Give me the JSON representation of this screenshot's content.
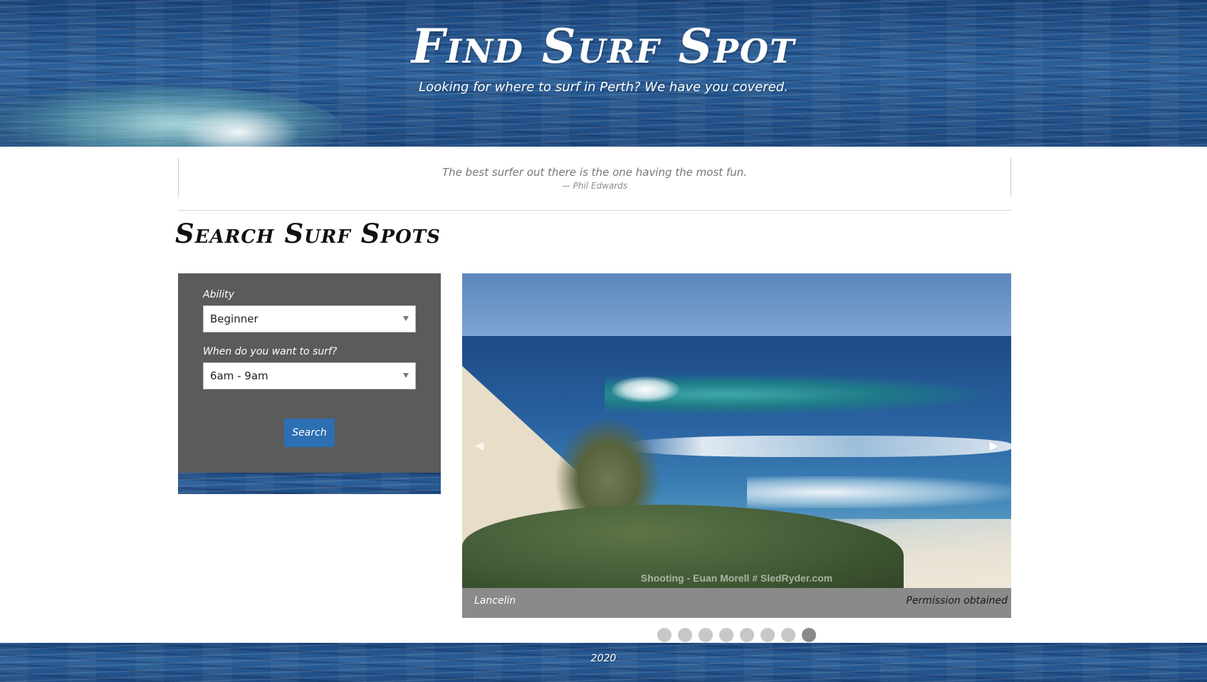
{
  "header": {
    "title": "Find Surf Spot",
    "subtitle": "Looking for where to surf in Perth? We have you covered."
  },
  "quote": {
    "text": "The best surfer out there is the one having the most fun.",
    "author": "— Phil Edwards"
  },
  "section": {
    "title": "Search Surf Spots"
  },
  "search_form": {
    "ability_label": "Ability",
    "ability_value": "Beginner",
    "time_label": "When do you want to surf?",
    "time_value": "6am - 9am",
    "search_button_label": "Search"
  },
  "carousel": {
    "caption": "Lancelin",
    "credit": "Permission obtained",
    "watermark": "Shooting - Euan Morell # SledRyder.com",
    "prev_icon": "◀",
    "next_icon": "▶",
    "dot_count": 8,
    "active_dot": 8
  },
  "footer": {
    "year": "2020"
  },
  "colors": {
    "panel_background": "#5b5b5b",
    "button_blue": "#2c6fb3",
    "caption_bar": "#8a8a8a",
    "dot_inactive": "#c8c8c8",
    "dot_active": "#8a8a8a"
  }
}
